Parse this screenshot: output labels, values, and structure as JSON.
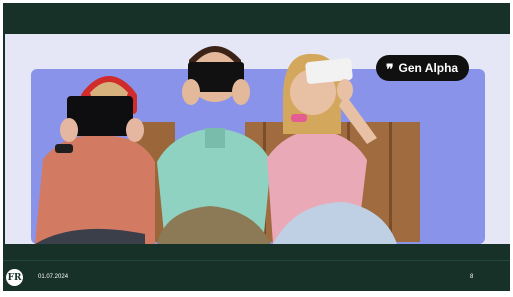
{
  "slide": {
    "tag_label": "Gen Alpha",
    "tag_icon": "quote-icon",
    "date": "01.07.2024",
    "page_number": "8",
    "logo_text": "FR"
  },
  "colors": {
    "frame": "#173128",
    "content_background": "#e5e7f6",
    "panel": "#8a93ea",
    "tag_background": "#101010",
    "tag_text": "#ffffff"
  }
}
